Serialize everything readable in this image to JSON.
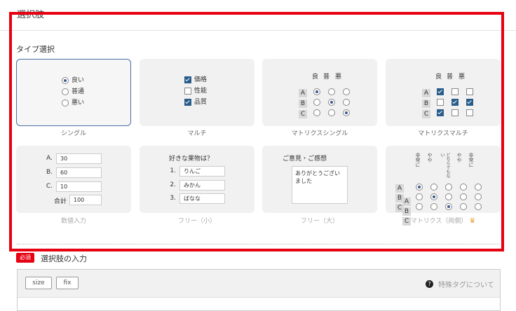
{
  "section": {
    "title": "選択肢"
  },
  "type_select": {
    "label": "タイプ選択"
  },
  "types": {
    "single": {
      "caption": "シングル",
      "options": [
        {
          "label": "良い",
          "checked": true
        },
        {
          "label": "普通",
          "checked": false
        },
        {
          "label": "悪い",
          "checked": false
        }
      ]
    },
    "multi": {
      "caption": "マルチ",
      "options": [
        {
          "label": "価格",
          "checked": true
        },
        {
          "label": "性能",
          "checked": false
        },
        {
          "label": "品質",
          "checked": true
        }
      ]
    },
    "matrix_single": {
      "caption": "マトリクスシングル",
      "columns": [
        "良",
        "普",
        "悪"
      ],
      "rows": [
        "A",
        "B",
        "C"
      ],
      "selected": [
        0,
        1,
        2
      ]
    },
    "matrix_multi": {
      "caption": "マトリクスマルチ",
      "columns": [
        "良",
        "普",
        "悪"
      ],
      "rows": [
        "A",
        "B",
        "C"
      ],
      "checked": [
        [
          true,
          false,
          false
        ],
        [
          false,
          true,
          true
        ],
        [
          true,
          false,
          false
        ]
      ]
    },
    "numeric": {
      "caption": "数値入力",
      "rows": [
        {
          "label": "A.",
          "value": "30"
        },
        {
          "label": "B.",
          "value": "60"
        },
        {
          "label": "C.",
          "value": "10"
        }
      ],
      "total_label": "合計",
      "total_value": "100"
    },
    "free_small": {
      "caption": "フリー（小）",
      "question": "好きな果物は？",
      "rows": [
        {
          "label": "1.",
          "value": "りんご"
        },
        {
          "label": "2.",
          "value": "みかん"
        },
        {
          "label": "3.",
          "value": "ばなな"
        }
      ]
    },
    "free_large": {
      "caption": "フリー（大）",
      "title": "ご意見・ご感想",
      "text": "ありがとうございました"
    },
    "matrix_both": {
      "caption": "マトリクス（両側）",
      "columns": [
        "非常に",
        "やや",
        "どちらでもない",
        "やや",
        "非常に"
      ],
      "rows_left": [
        "A",
        "B",
        "C"
      ],
      "rows_right": [
        "A",
        "B",
        "C"
      ],
      "selected": [
        0,
        1,
        2,
        3,
        4
      ]
    }
  },
  "choices_input": {
    "required_badge": "必須",
    "label": "選択肢の入力",
    "buttons": [
      "size",
      "fix"
    ],
    "help_icon": "question-circle-icon",
    "help_text": "特殊タグについて"
  },
  "colors": {
    "highlight": "#e60012",
    "accent": "#2b5d8a"
  }
}
